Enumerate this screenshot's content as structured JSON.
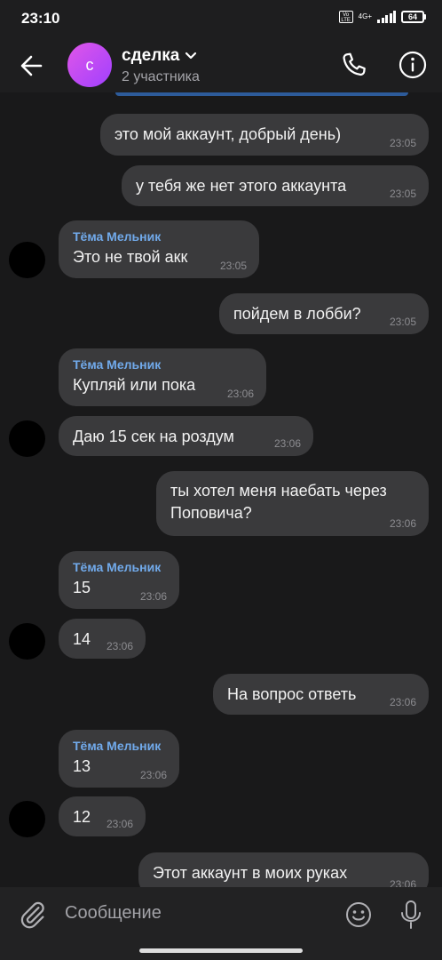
{
  "status": {
    "time": "23:10",
    "network": "4G+",
    "battery": "64"
  },
  "header": {
    "title": "сделка",
    "subtitle": "2 участника",
    "avatar_letter": "с"
  },
  "messages": [
    {
      "dir": "out",
      "text": "это мой аккаунт, добрый день)",
      "time": "23:05"
    },
    {
      "dir": "out",
      "text": "у тебя же нет этого аккаунта",
      "time": "23:05"
    },
    {
      "dir": "in",
      "sender": "Тёма Мельник",
      "text": "Это не твой акк",
      "time": "23:05"
    },
    {
      "dir": "out",
      "text": "пойдем в лобби?",
      "time": "23:05"
    },
    {
      "dir": "in",
      "sender": "Тёма Мельник",
      "text": "Купляй или пока",
      "time": "23:06"
    },
    {
      "dir": "in",
      "text": "Даю 15 сек на роздум",
      "time": "23:06"
    },
    {
      "dir": "out",
      "text": "ты хотел меня наебать через Поповича?",
      "time": "23:06"
    },
    {
      "dir": "in",
      "sender": "Тёма Мельник",
      "text": "15",
      "time": "23:06"
    },
    {
      "dir": "in",
      "text": "14",
      "time": "23:06"
    },
    {
      "dir": "out",
      "text": "На вопрос ответь",
      "time": "23:06"
    },
    {
      "dir": "in",
      "sender": "Тёма Мельник",
      "text": "13",
      "time": "23:06"
    },
    {
      "dir": "in",
      "text": "12",
      "time": "23:06"
    },
    {
      "dir": "out",
      "text": "Этот аккаунт в моих руках",
      "time": "23:06"
    }
  ],
  "composer": {
    "placeholder": "Сообщение"
  },
  "colors": {
    "bubble": "#3a3a3c",
    "sender_name": "#71aaeb",
    "background": "#19191a"
  }
}
